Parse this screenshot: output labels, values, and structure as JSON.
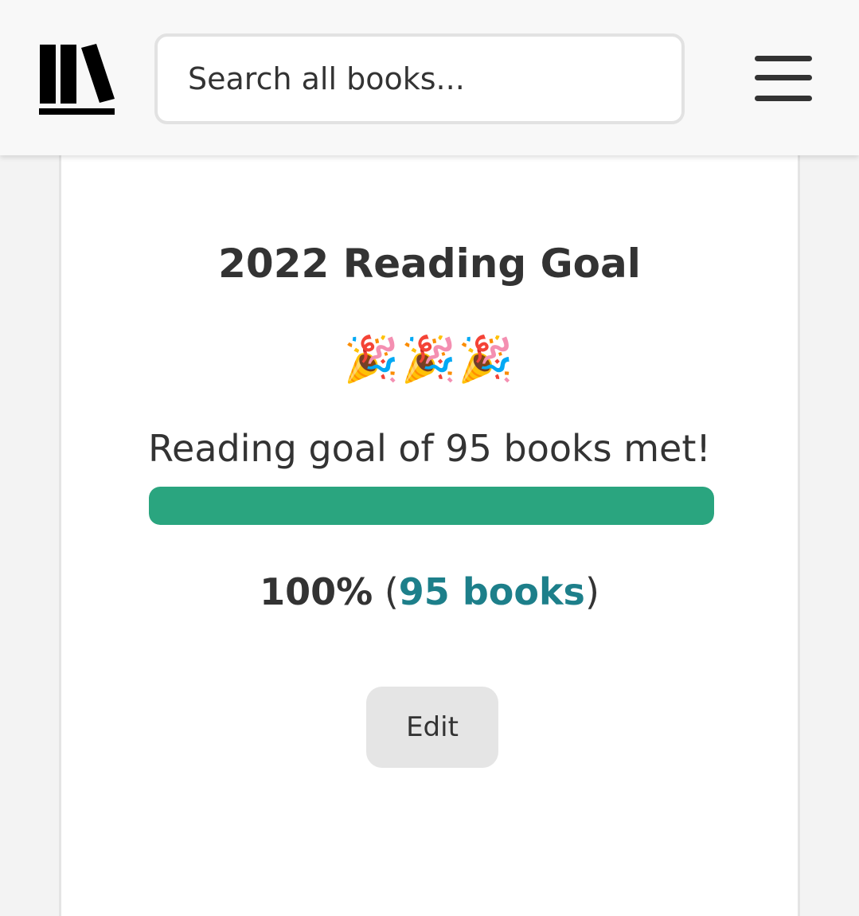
{
  "header": {
    "logo_icon": "bookshelf-icon",
    "search": {
      "placeholder": "Search all books...",
      "value": ""
    },
    "menu_icon": "hamburger-menu-icon"
  },
  "goal": {
    "title": "2022 Reading Goal",
    "celebration": "🎉🎉🎉",
    "celebration_icon": "party-popper-icon",
    "met_text": "Reading goal of 95 books met!",
    "progress_fraction": 1.0,
    "progress_color": "#2aa57f",
    "percent": "100%",
    "paren_open": " (",
    "books_link": "95 books",
    "paren_close": ")",
    "link_color": "#1d7f8a",
    "edit_label": "Edit"
  }
}
